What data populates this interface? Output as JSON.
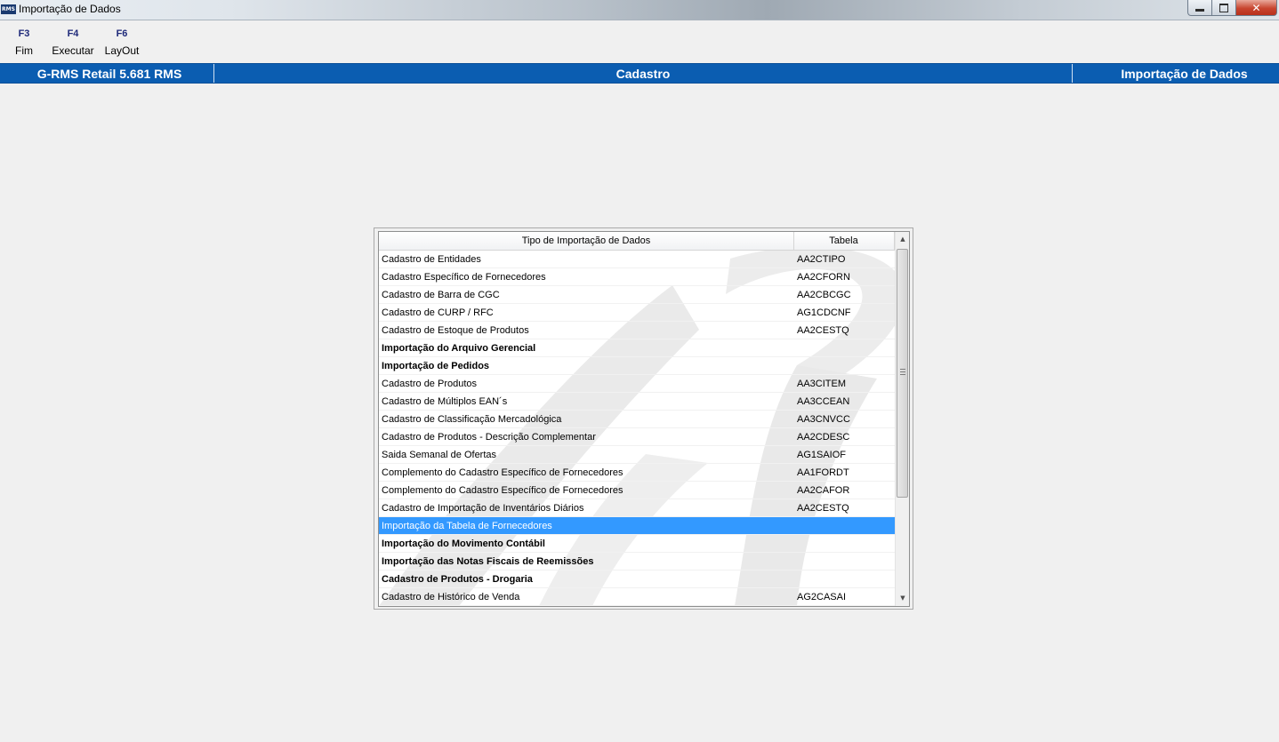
{
  "window": {
    "icon_text": "RMS",
    "title": "Importação de Dados",
    "close_glyph": "✕"
  },
  "toolbar": [
    {
      "key": "F3",
      "label": "Fim"
    },
    {
      "key": "F4",
      "label": "Executar"
    },
    {
      "key": "F6",
      "label": "LayOut"
    }
  ],
  "header": {
    "left": "G-RMS Retail 5.681 RMS",
    "center": "Cadastro",
    "right": "Importação de Dados",
    "color": "#0b5db1"
  },
  "grid": {
    "columns": [
      "Tipo de Importação de Dados",
      "Tabela"
    ],
    "selection_color": "#3399ff",
    "rows": [
      {
        "tipo": "Cadastro de Entidades",
        "tabela": "AA2CTIPO",
        "bold": false,
        "selected": false
      },
      {
        "tipo": "Cadastro Específico de Fornecedores",
        "tabela": "AA2CFORN",
        "bold": false,
        "selected": false
      },
      {
        "tipo": "Cadastro de Barra de CGC",
        "tabela": "AA2CBCGC",
        "bold": false,
        "selected": false
      },
      {
        "tipo": "Cadastro de CURP / RFC",
        "tabela": "AG1CDCNF",
        "bold": false,
        "selected": false
      },
      {
        "tipo": "Cadastro de Estoque de Produtos",
        "tabela": "AA2CESTQ",
        "bold": false,
        "selected": false
      },
      {
        "tipo": "Importação do Arquivo Gerencial",
        "tabela": "",
        "bold": true,
        "selected": false
      },
      {
        "tipo": "Importação de Pedidos",
        "tabela": "",
        "bold": true,
        "selected": false
      },
      {
        "tipo": "Cadastro de Produtos",
        "tabela": "AA3CITEM",
        "bold": false,
        "selected": false
      },
      {
        "tipo": "Cadastro de Múltiplos EAN´s",
        "tabela": "AA3CCEAN",
        "bold": false,
        "selected": false
      },
      {
        "tipo": "Cadastro de Classificação Mercadológica",
        "tabela": "AA3CNVCC",
        "bold": false,
        "selected": false
      },
      {
        "tipo": "Cadastro de Produtos - Descrição Complementar",
        "tabela": "AA2CDESC",
        "bold": false,
        "selected": false
      },
      {
        "tipo": "Saida Semanal de Ofertas",
        "tabela": "AG1SAIOF",
        "bold": false,
        "selected": false
      },
      {
        "tipo": "Complemento do Cadastro Específico de Fornecedores",
        "tabela": "AA1FORDT",
        "bold": false,
        "selected": false
      },
      {
        "tipo": "Complemento do Cadastro Específico de Fornecedores",
        "tabela": "AA2CAFOR",
        "bold": false,
        "selected": false
      },
      {
        "tipo": "Cadastro de Importação de Inventários Diários",
        "tabela": "AA2CESTQ",
        "bold": false,
        "selected": false
      },
      {
        "tipo": "Importação da Tabela de Fornecedores",
        "tabela": "",
        "bold": false,
        "selected": true
      },
      {
        "tipo": "Importação do Movimento Contábil",
        "tabela": "",
        "bold": true,
        "selected": false
      },
      {
        "tipo": "Importação das Notas Fiscais de Reemissões",
        "tabela": "",
        "bold": true,
        "selected": false
      },
      {
        "tipo": "Cadastro de Produtos - Drogaria",
        "tabela": "",
        "bold": true,
        "selected": false
      },
      {
        "tipo": "Cadastro de Histórico de Venda",
        "tabela": "AG2CASAI",
        "bold": false,
        "selected": false
      }
    ]
  },
  "scrollbar": {
    "up_glyph": "▲",
    "down_glyph": "▼"
  }
}
